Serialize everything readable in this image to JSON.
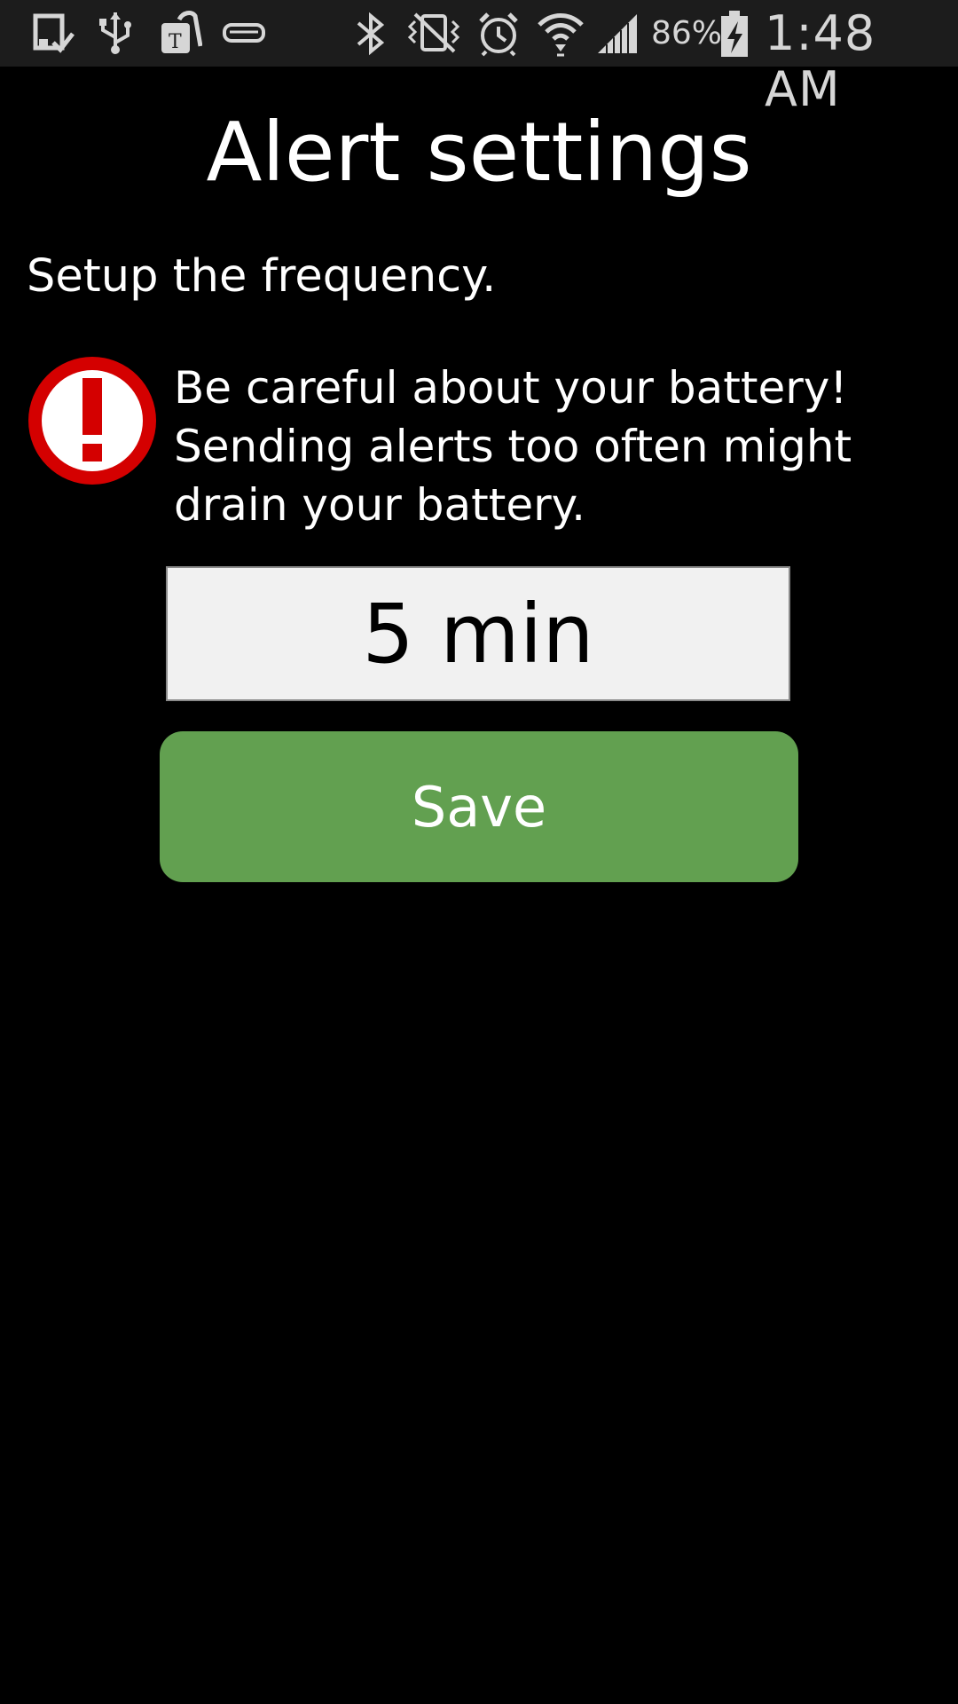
{
  "status_bar": {
    "icons": [
      "screenshot-saved-icon",
      "usb-icon",
      "carrier-icon",
      "cradle-icon",
      "bluetooth-icon",
      "vibrate-icon",
      "alarm-icon",
      "wifi-icon",
      "signal-icon",
      "battery-charging-icon"
    ],
    "battery_percent": "86%",
    "time": "1:48 AM",
    "battery_level": 0.86
  },
  "page": {
    "title": "Alert settings",
    "instruction": "Setup the frequency.",
    "warning": {
      "icon": "exclamation-icon",
      "icon_color": "#d40000",
      "lines": [
        "Be careful about your battery!",
        "Sending alerts too often might",
        "drain your battery."
      ]
    },
    "frequency_value": "5 min",
    "save_label": "Save",
    "save_color": "#62a050"
  }
}
